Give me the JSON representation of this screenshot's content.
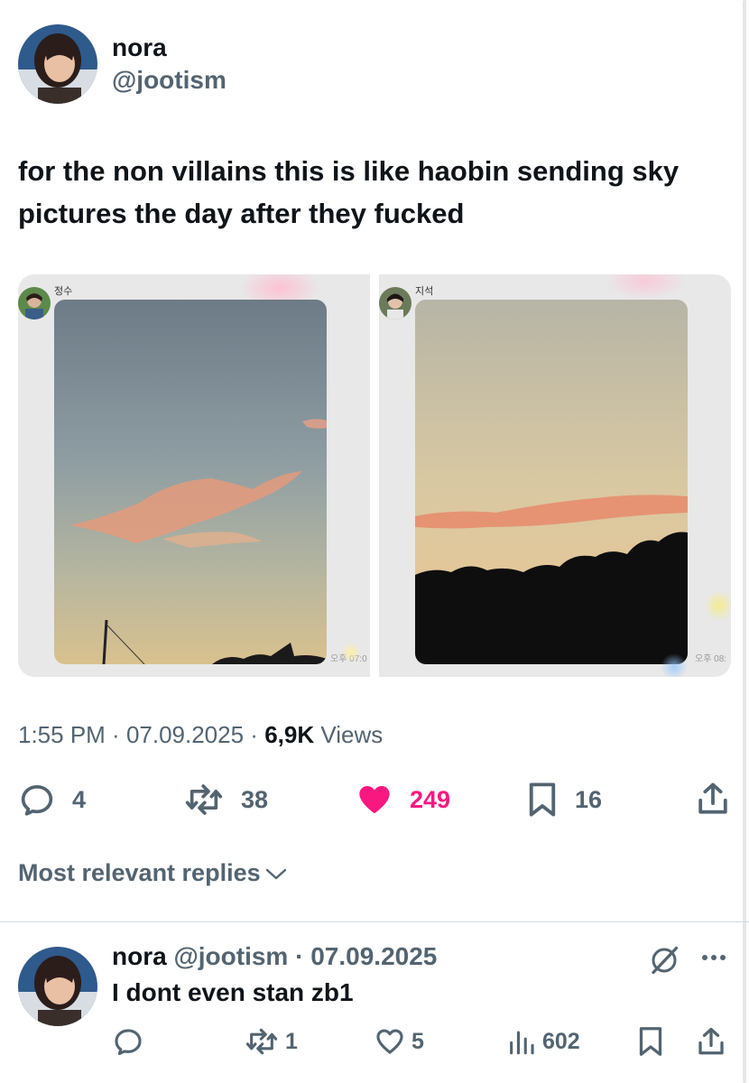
{
  "tweet": {
    "author_name": "nora",
    "author_handle": "@jootism",
    "text": "for the non villains this is like haobin sending sky pictures the day after they fucked",
    "time": "1:55 PM",
    "date": "07.09.2025",
    "views_count": "6,9K",
    "views_label": "Views",
    "replies": "4",
    "reposts": "38",
    "likes": "249",
    "bookmarks": "16"
  },
  "media": [
    {
      "chat_name": "정수",
      "time": "오후 07:0"
    },
    {
      "chat_name": "지석",
      "time": "오후 08:"
    }
  ],
  "replies_sort_label": "Most relevant replies",
  "reply": {
    "author_name": "nora",
    "author_handle": "@jootism",
    "date": "07.09.2025",
    "text": "I dont even stan zb1",
    "replies": "",
    "reposts": "1",
    "likes": "5",
    "views": "602"
  },
  "colors": {
    "text": "#0f1419",
    "muted": "#536471",
    "like": "#f91880",
    "divider": "#cfd9de"
  },
  "icons": [
    "reply-icon",
    "repost-icon",
    "heart-icon",
    "bookmark-icon",
    "share-icon",
    "chevron-down-icon",
    "grok-icon",
    "more-icon",
    "views-icon"
  ]
}
